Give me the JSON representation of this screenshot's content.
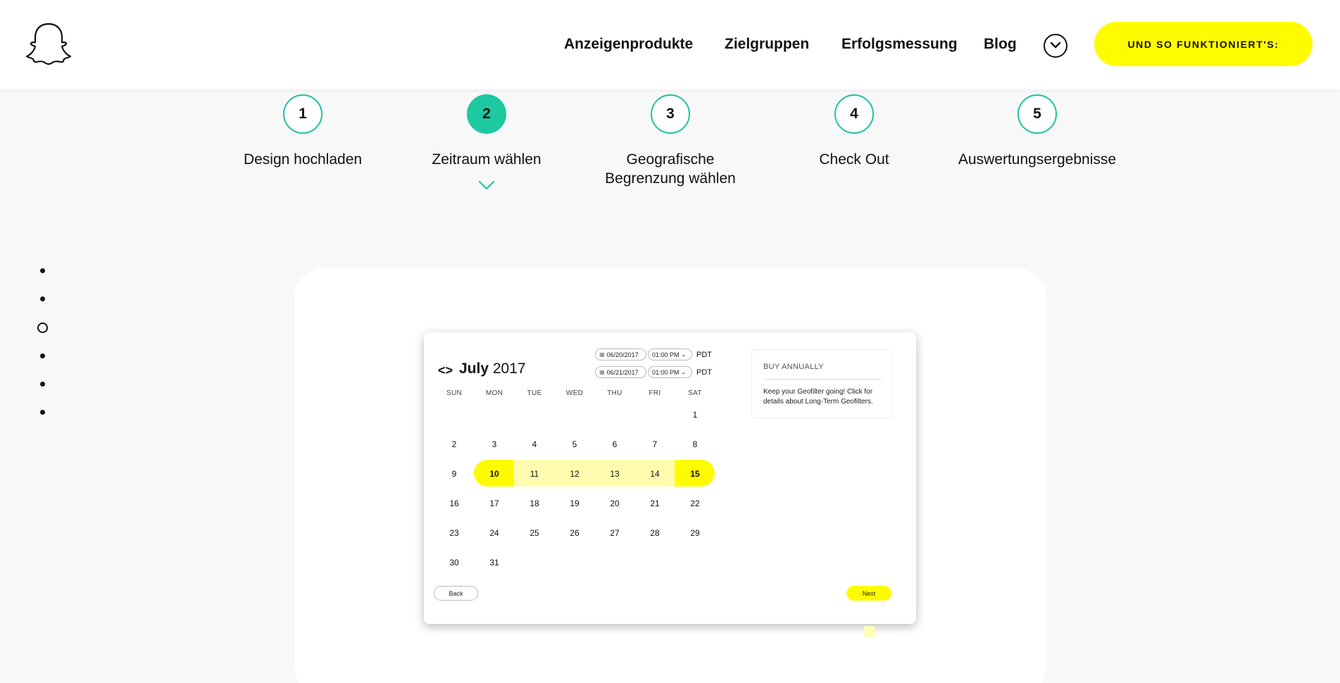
{
  "header": {
    "nav": [
      {
        "label": "Anzeigenprodukte"
      },
      {
        "label": "Zielgruppen"
      },
      {
        "label": "Erfolgsmessung"
      },
      {
        "label": "Blog"
      }
    ],
    "cta_label": "UND SO FUNKTIONIERT'S:",
    "cta_color": "#fffc00"
  },
  "steps": [
    {
      "number": "1",
      "label": "Design hochladen"
    },
    {
      "number": "2",
      "label": "Zeitraum wählen",
      "active": true
    },
    {
      "number": "3",
      "label": "Geografische Begrenzung wählen"
    },
    {
      "number": "4",
      "label": "Check Out"
    },
    {
      "number": "5",
      "label": "Auswertungsergebnisse"
    }
  ],
  "accent_color": "#1dc9a1",
  "side_dots": {
    "count": 6,
    "active_index": 2
  },
  "calendar": {
    "month": "July",
    "year": "2017",
    "start_date": "06/20/2017",
    "start_time": "01:00 PM",
    "end_date": "06/21/2017",
    "end_time": "01:00 PM",
    "timezone": "PDT",
    "weekdays": [
      "SUN",
      "MON",
      "TUE",
      "WED",
      "THU",
      "FRI",
      "SAT"
    ],
    "weeks": [
      [
        "",
        "",
        "",
        "",
        "",
        "",
        "1"
      ],
      [
        "2",
        "3",
        "4",
        "5",
        "6",
        "7",
        "8"
      ],
      [
        "9",
        "10",
        "11",
        "12",
        "13",
        "14",
        "15"
      ],
      [
        "16",
        "17",
        "18",
        "19",
        "20",
        "21",
        "22"
      ],
      [
        "23",
        "24",
        "25",
        "26",
        "27",
        "28",
        "29"
      ],
      [
        "30",
        "31",
        "",
        "",
        "",
        "",
        ""
      ]
    ],
    "selected_range": [
      "10",
      "15"
    ],
    "buy_title": "BUY ANNUALLY",
    "buy_text": "Keep your Geofilter going! Click for details about Long-Term Geofilters.",
    "back_label": "Back",
    "next_label": "Next",
    "highlight_color": "#fffc00",
    "range_color": "#fffcaf"
  }
}
